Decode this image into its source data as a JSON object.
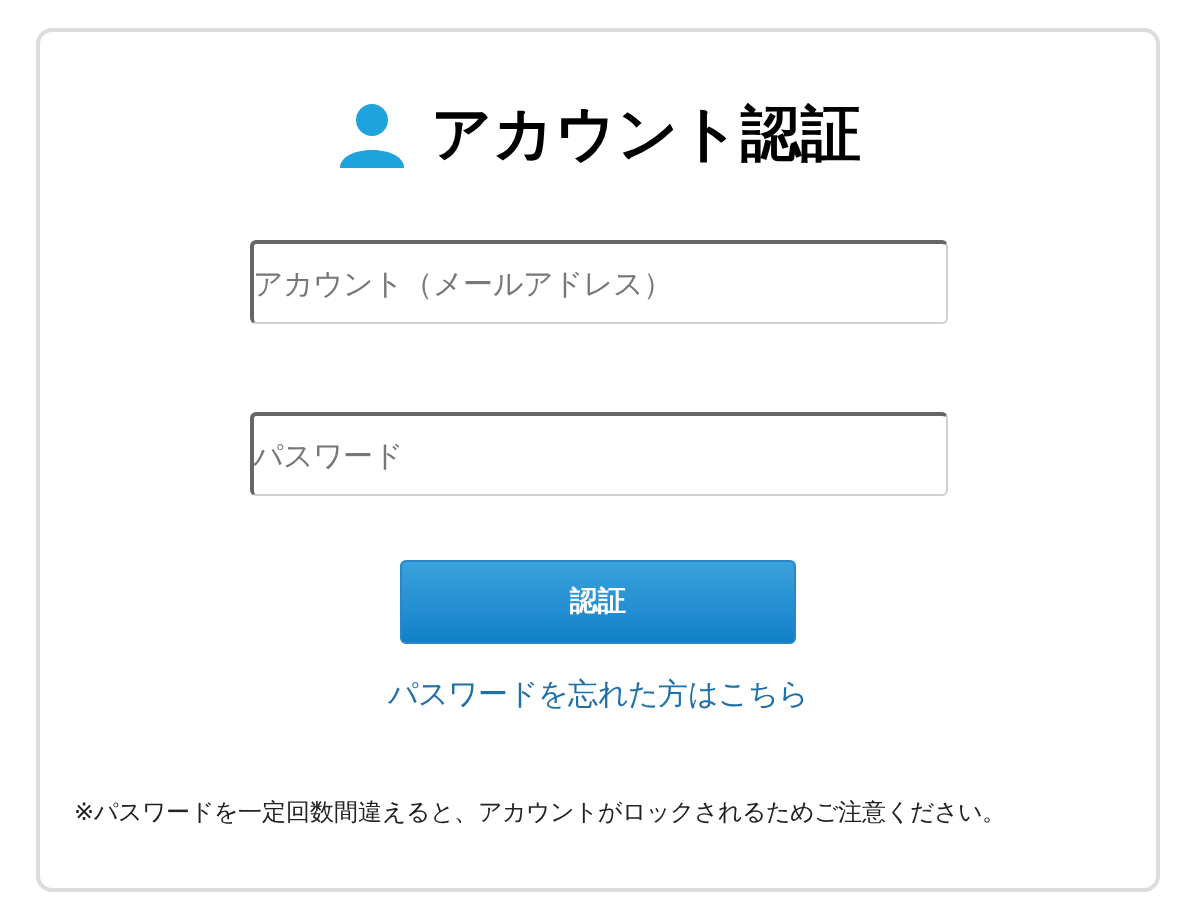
{
  "title": "アカウント認証",
  "fields": [
    {
      "placeholder": "アカウント（メールアドレス）"
    },
    {
      "placeholder": "パスワード"
    }
  ],
  "submit_button": "認証",
  "forgot_link": "パスワードを忘れた方はこちら",
  "notice": "※パスワードを一定回数間違えると、アカウントがロックされるためご注意ください。"
}
